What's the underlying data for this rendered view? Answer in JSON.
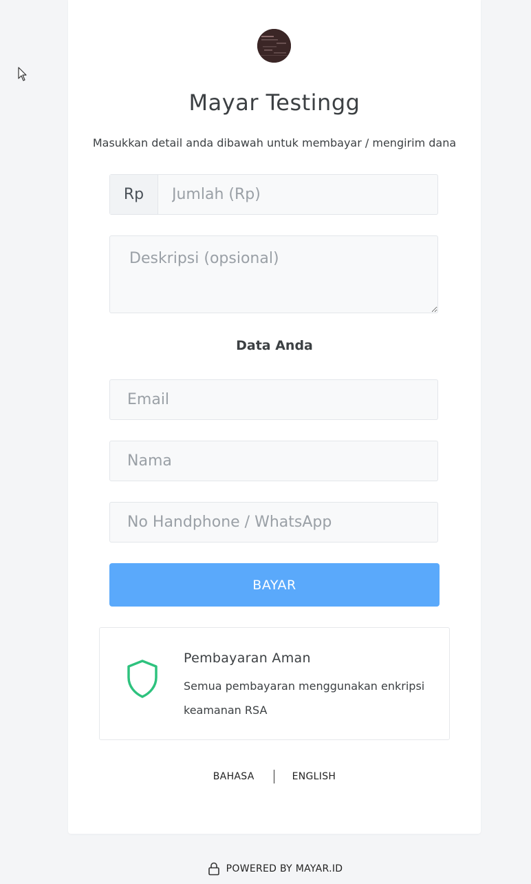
{
  "merchant": {
    "name": "Mayar Testingg",
    "subtitle": "Masukkan detail anda dibawah untuk membayar / mengirim dana"
  },
  "form": {
    "amount_prefix": "Rp",
    "amount_placeholder": "Jumlah (Rp)",
    "description_placeholder": "Deskripsi (opsional)",
    "section_title": "Data Anda",
    "email_placeholder": "Email",
    "name_placeholder": "Nama",
    "phone_placeholder": "No Handphone / WhatsApp",
    "submit_label": "BAYAR"
  },
  "security": {
    "icon": "shield-icon",
    "title": "Pembayaran Aman",
    "text": "Semua pembayaran menggunakan enkripsi keamanan RSA"
  },
  "language": {
    "label": "BAHASA",
    "current": "ENGLISH"
  },
  "footer": {
    "icon": "lock-icon",
    "text": "POWERED BY MAYAR.ID"
  },
  "colors": {
    "button": "#5aa9fb",
    "shield": "#2ec27e",
    "background": "#f4f5f7"
  }
}
